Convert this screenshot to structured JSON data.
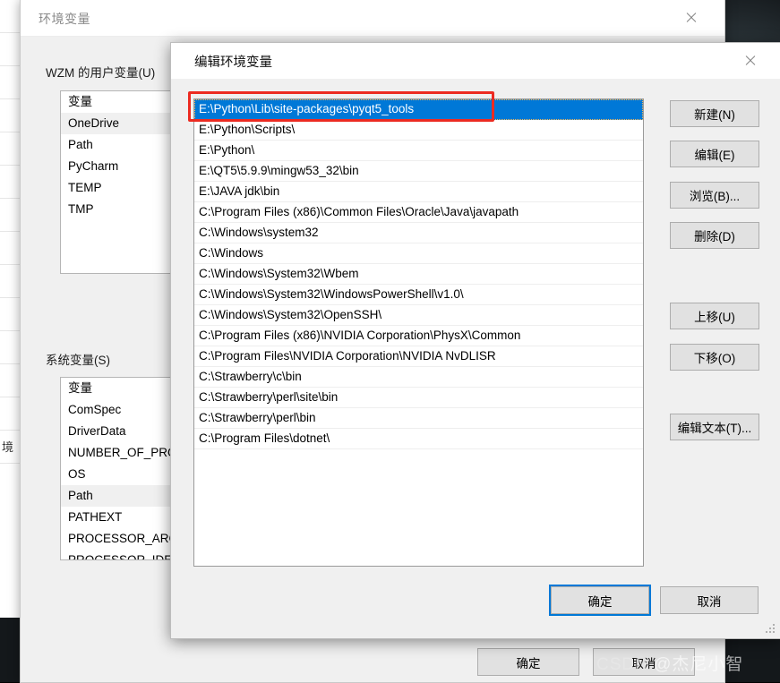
{
  "env_window": {
    "title": "环境变量",
    "close_icon": "close-icon",
    "user_vars": {
      "label": "WZM 的用户变量(U)",
      "column_header": "变量",
      "rows": [
        {
          "name": "OneDrive",
          "selected": true
        },
        {
          "name": "Path",
          "selected": false
        },
        {
          "name": "PyCharm",
          "selected": false
        },
        {
          "name": "TEMP",
          "selected": false
        },
        {
          "name": "TMP",
          "selected": false
        }
      ]
    },
    "system_vars": {
      "label": "系统变量(S)",
      "column_header": "变量",
      "rows": [
        {
          "name": "ComSpec",
          "selected": false
        },
        {
          "name": "DriverData",
          "selected": false
        },
        {
          "name": "NUMBER_OF_PROC",
          "selected": false
        },
        {
          "name": "OS",
          "selected": false
        },
        {
          "name": "Path",
          "selected": true
        },
        {
          "name": "PATHEXT",
          "selected": false
        },
        {
          "name": "PROCESSOR_ARCH",
          "selected": false
        },
        {
          "name": "PROCESSOR_IDENT",
          "selected": false
        }
      ]
    },
    "ok_label": "确定",
    "cancel_label": "取消"
  },
  "edit_dialog": {
    "title": "编辑环境变量",
    "close_icon": "close-icon",
    "paths": [
      {
        "value": "E:\\Python\\Lib\\site-packages\\pyqt5_tools",
        "selected": true
      },
      {
        "value": "E:\\Python\\Scripts\\",
        "selected": false
      },
      {
        "value": "E:\\Python\\",
        "selected": false
      },
      {
        "value": "E:\\QT5\\5.9.9\\mingw53_32\\bin",
        "selected": false
      },
      {
        "value": "E:\\JAVA jdk\\bin",
        "selected": false
      },
      {
        "value": "C:\\Program Files (x86)\\Common Files\\Oracle\\Java\\javapath",
        "selected": false
      },
      {
        "value": "C:\\Windows\\system32",
        "selected": false
      },
      {
        "value": "C:\\Windows",
        "selected": false
      },
      {
        "value": "C:\\Windows\\System32\\Wbem",
        "selected": false
      },
      {
        "value": "C:\\Windows\\System32\\WindowsPowerShell\\v1.0\\",
        "selected": false
      },
      {
        "value": "C:\\Windows\\System32\\OpenSSH\\",
        "selected": false
      },
      {
        "value": "C:\\Program Files (x86)\\NVIDIA Corporation\\PhysX\\Common",
        "selected": false
      },
      {
        "value": "C:\\Program Files\\NVIDIA Corporation\\NVIDIA NvDLISR",
        "selected": false
      },
      {
        "value": "C:\\Strawberry\\c\\bin",
        "selected": false
      },
      {
        "value": "C:\\Strawberry\\perl\\site\\bin",
        "selected": false
      },
      {
        "value": "C:\\Strawberry\\perl\\bin",
        "selected": false
      },
      {
        "value": "C:\\Program Files\\dotnet\\",
        "selected": false
      }
    ],
    "buttons": {
      "new": "新建(N)",
      "edit": "编辑(E)",
      "browse": "浏览(B)...",
      "delete": "删除(D)",
      "move_up": "上移(U)",
      "move_down": "下移(O)",
      "edit_text": "编辑文本(T)..."
    },
    "ok_label": "确定",
    "cancel_label": "取消",
    "highlight_color": "#ec2b21",
    "selection_color": "#0078d7",
    "focus_color": "#0078d7"
  },
  "background_window": {
    "partial_text": "境"
  },
  "watermark": {
    "csdn": "CSDN",
    "author": "@杰尼小智"
  }
}
